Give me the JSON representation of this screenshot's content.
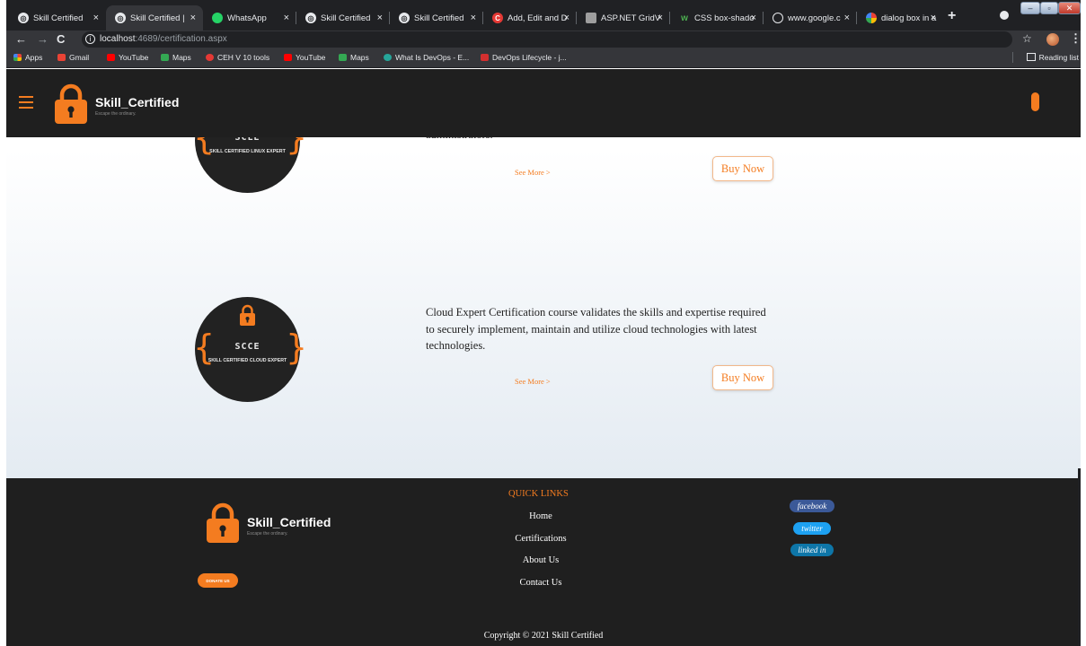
{
  "browser": {
    "tabs": [
      {
        "title": "Skill Certified",
        "active": false,
        "favicon": "globe-icon"
      },
      {
        "title": "Skill Certified |",
        "active": true,
        "favicon": "globe-icon"
      },
      {
        "title": "WhatsApp",
        "active": false,
        "favicon": "whatsapp-icon"
      },
      {
        "title": "Skill Certified",
        "active": false,
        "favicon": "globe-icon"
      },
      {
        "title": "Skill Certified",
        "active": false,
        "favicon": "globe-icon"
      },
      {
        "title": "Add, Edit and D",
        "active": false,
        "favicon": "c-sharpcorner-icon"
      },
      {
        "title": "ASP.NET GridV",
        "active": false,
        "favicon": "grid-icon"
      },
      {
        "title": "CSS box-shado",
        "active": false,
        "favicon": "w3schools-icon"
      },
      {
        "title": "www.google.c",
        "active": false,
        "favicon": "globe-icon"
      },
      {
        "title": "dialog box in a",
        "active": false,
        "favicon": "google-icon"
      }
    ],
    "tab_close_glyph": "×",
    "new_tab_glyph": "+",
    "url_host": "localhost",
    "url_rest": ":4689/certification.aspx",
    "bookmarks": [
      {
        "label": "Apps",
        "color": "#f4b400"
      },
      {
        "label": "Gmail",
        "color": "#ea4335"
      },
      {
        "label": "YouTube",
        "color": "#ff0000"
      },
      {
        "label": "Maps",
        "color": "#34a853"
      },
      {
        "label": "CEH V 10 tools",
        "color": "#e53935"
      },
      {
        "label": "YouTube",
        "color": "#ff0000"
      },
      {
        "label": "Maps",
        "color": "#34a853"
      },
      {
        "label": "What Is DevOps - E...",
        "color": "#26a69a"
      },
      {
        "label": "DevOps Lifecycle - j...",
        "color": "#d32f2f"
      }
    ],
    "reading_list": "Reading list"
  },
  "site": {
    "brand": "Skill_Certified",
    "tagline": "Escape the ordinary.",
    "accent_color": "#f47c20"
  },
  "certifications": [
    {
      "code": "SCLE",
      "subtitle": "SKILL CERTIFIED LINUX EXPERT",
      "description_fragment": "administrators.",
      "see_more": "See More  >",
      "buy_label": "Buy Now"
    },
    {
      "code": "SCCE",
      "subtitle": "SKILL CERTIFIED CLOUD EXPERT",
      "description": "Cloud Expert Certification course validates the skills and expertise required to securely implement, maintain and utilize cloud technologies with latest technologies.",
      "see_more": "See More  >",
      "buy_label": "Buy Now"
    }
  ],
  "footer": {
    "quick_links_title": "QUICK LINKS",
    "links": [
      "Home",
      "Certifications",
      "About Us",
      "Contact Us"
    ],
    "donate_label": "DONATE US",
    "social": [
      {
        "label": "facebook",
        "color": "#3b5998"
      },
      {
        "label": "twitter",
        "color": "#1da1f2"
      },
      {
        "label": "linked in",
        "color": "#0e76a8"
      }
    ],
    "copyright": "Copyright © 2021 Skill Certified"
  }
}
